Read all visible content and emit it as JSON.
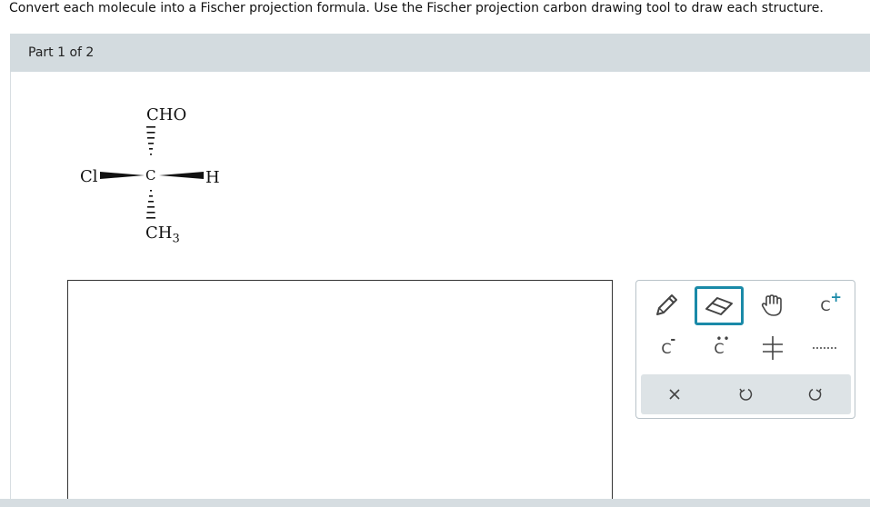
{
  "instructions": "Convert each molecule into a Fischer projection formula. Use the Fischer projection carbon drawing tool to draw each structure.",
  "part": {
    "label": "Part 1 of 2"
  },
  "molecule": {
    "top": "CHO",
    "center": "C",
    "left": "Cl",
    "right": "H",
    "bottom_main": "CH",
    "bottom_sub": "3"
  },
  "tools": {
    "row1": [
      {
        "name": "pencil-icon",
        "selected": false
      },
      {
        "name": "eraser-icon",
        "selected": true
      },
      {
        "name": "hand-icon",
        "selected": false
      },
      {
        "name": "carbocation-icon",
        "label": "C",
        "sup": "+"
      }
    ],
    "row2": [
      {
        "name": "carbanion-icon",
        "label": "C",
        "sup": "-"
      },
      {
        "name": "carbon-lone-pair-icon",
        "label": "C"
      },
      {
        "name": "fischer-cross-icon"
      },
      {
        "name": "dotted-bond-icon"
      }
    ],
    "actions": [
      "close-icon",
      "undo-icon",
      "redo-icon"
    ]
  }
}
